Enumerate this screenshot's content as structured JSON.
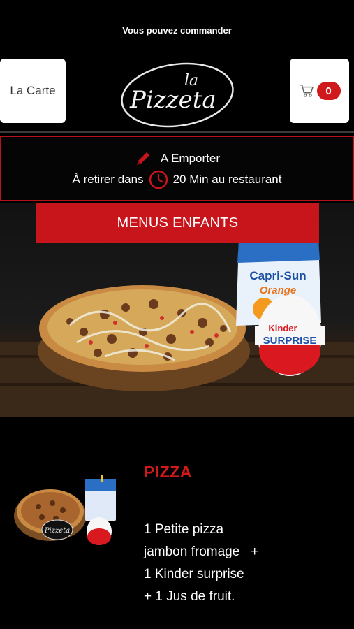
{
  "status": {
    "text": "Vous pouvez commander"
  },
  "header": {
    "menu_button_label": "La Carte",
    "cart_count": "0",
    "logo_text_top": "la",
    "logo_text_main": "Pizzeta"
  },
  "order": {
    "mode_label": "A Emporter",
    "pickup_prefix": "À retirer dans",
    "pickup_suffix": "20 Min au restaurant"
  },
  "banner": {
    "title": "MENUS ENFANTS",
    "drink_brand": "Capri-Sun",
    "drink_flavor": "Orange",
    "egg_brand": "Kinder",
    "egg_name": "SURPRISE"
  },
  "product": {
    "name": "PIZZA",
    "description_lines": [
      "1 Petite pizza",
      "jambon fromage   +",
      "1 Kinder surprise",
      "+ 1 Jus de fruit."
    ],
    "thumb_logo": "Pizzeta"
  },
  "colors": {
    "accent": "#d0191a",
    "background": "#000000",
    "button_bg": "#ffffff"
  }
}
